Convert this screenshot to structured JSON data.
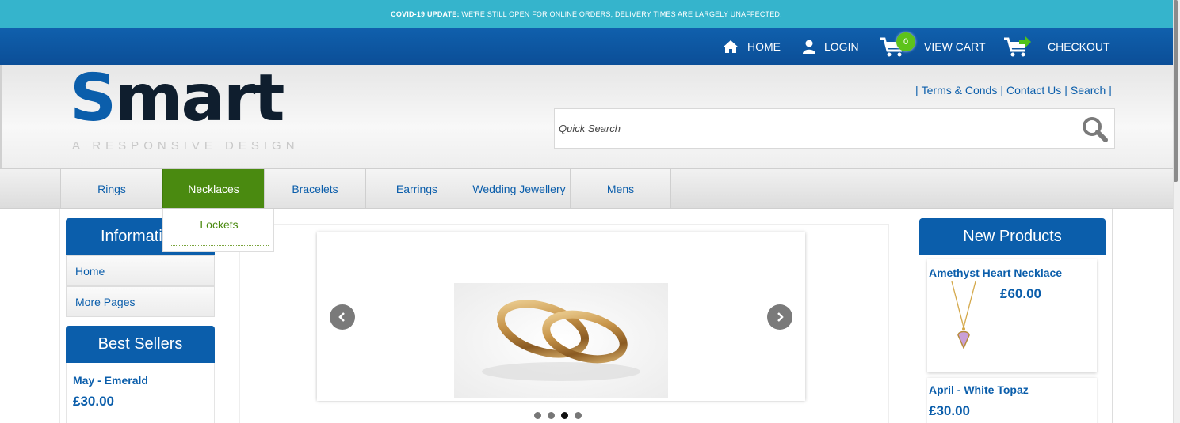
{
  "banner": {
    "bold": "COVID-19 UPDATE:",
    "text": " WE'RE STILL OPEN FOR ONLINE ORDERS, DELIVERY TIMES ARE LARGELY UNAFFECTED."
  },
  "topnav": {
    "home": "HOME",
    "login": "LOGIN",
    "cart_count": "0",
    "view_cart": "VIEW CART",
    "checkout": "CHECKOUT"
  },
  "logo": {
    "s": "S",
    "rest": "mart",
    "tagline": "A RESPONSIVE DESIGN"
  },
  "toplinks": {
    "terms": "Terms & Conds",
    "contact": "Contact Us",
    "search": "Search"
  },
  "search": {
    "placeholder": "Quick Search"
  },
  "categories": [
    "Rings",
    "Necklaces",
    "Bracelets",
    "Earrings",
    "Wedding Jewellery",
    "Mens"
  ],
  "dropdown": {
    "item": "Lockets"
  },
  "information": {
    "title": "Information",
    "items": [
      "Home",
      "More Pages"
    ]
  },
  "best_sellers": {
    "title": "Best Sellers",
    "product": "May - Emerald",
    "price": "£30.00"
  },
  "new_products": {
    "title": "New Products",
    "items": [
      {
        "name": "Amethyst Heart Necklace",
        "price": "£60.00"
      },
      {
        "name": "April - White Topaz",
        "price": "£30.00"
      }
    ]
  },
  "slider": {
    "dot_count": 4,
    "active_dot": 3
  },
  "colors": {
    "brand_blue": "#0b5eab",
    "banner": "#35b4cc",
    "active_green": "#4a8a10",
    "badge_green": "#5dc31b"
  }
}
